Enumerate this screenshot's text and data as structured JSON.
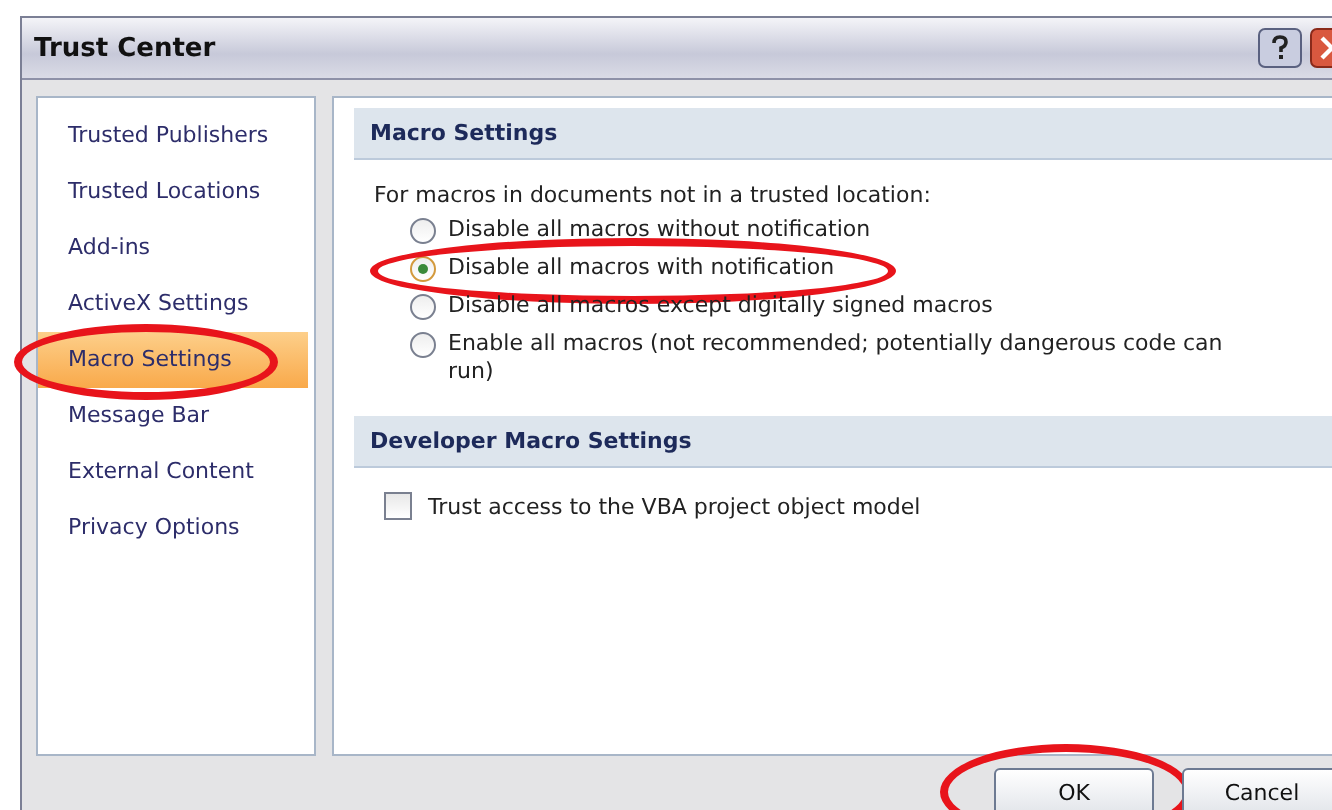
{
  "window": {
    "title": "Trust Center"
  },
  "sidebar": {
    "items": [
      {
        "label": "Trusted Publishers",
        "selected": false,
        "circled": false
      },
      {
        "label": "Trusted Locations",
        "selected": false,
        "circled": false
      },
      {
        "label": "Add-ins",
        "selected": false,
        "circled": false
      },
      {
        "label": "ActiveX Settings",
        "selected": false,
        "circled": false
      },
      {
        "label": "Macro Settings",
        "selected": true,
        "circled": true
      },
      {
        "label": "Message Bar",
        "selected": false,
        "circled": false
      },
      {
        "label": "External Content",
        "selected": false,
        "circled": false
      },
      {
        "label": "Privacy Options",
        "selected": false,
        "circled": false
      }
    ]
  },
  "macro_settings": {
    "heading": "Macro Settings",
    "intro": "For macros in documents not in a trusted location:",
    "options": [
      {
        "label": "Disable all macros without notification",
        "selected": false,
        "circled": false
      },
      {
        "label": "Disable all macros with notification",
        "selected": true,
        "circled": true
      },
      {
        "label": "Disable all macros except digitally signed macros",
        "selected": false,
        "circled": false
      },
      {
        "label": "Enable all macros (not recommended; potentially dangerous code can run)",
        "selected": false,
        "circled": false
      }
    ]
  },
  "developer_settings": {
    "heading": "Developer Macro Settings",
    "checkbox": {
      "label": "Trust access to the VBA project object model",
      "checked": false
    }
  },
  "buttons": [
    {
      "label": "OK",
      "circled": true
    },
    {
      "label": "Cancel",
      "circled": false
    }
  ]
}
